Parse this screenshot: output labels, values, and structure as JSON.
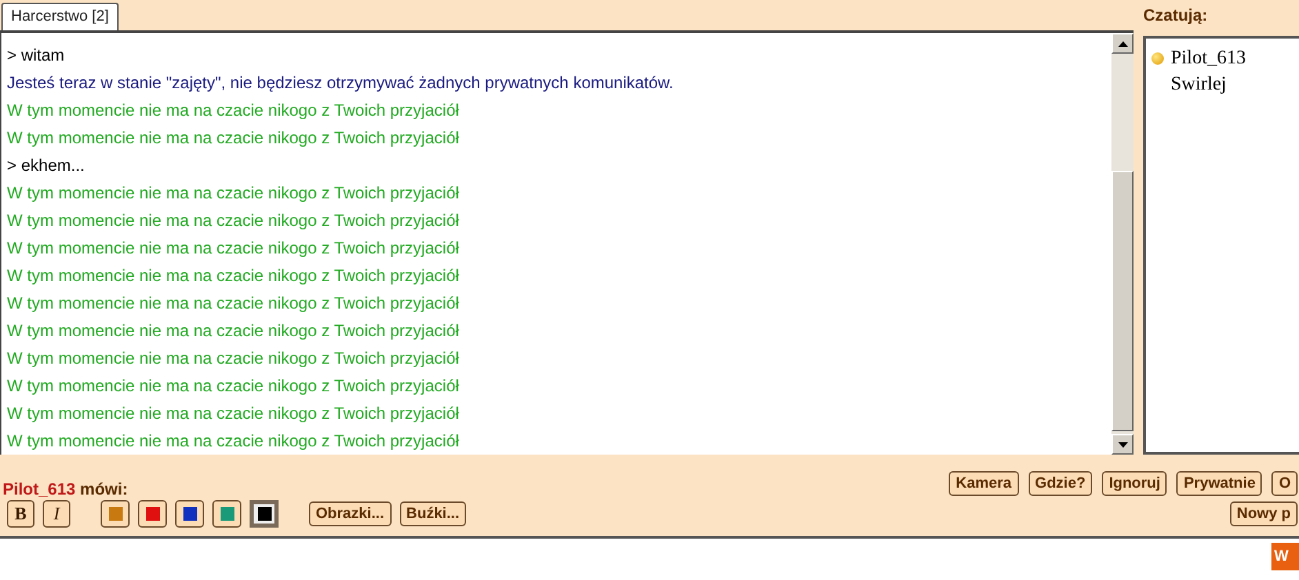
{
  "tabs": [
    {
      "label": "Harcerstwo [2]",
      "selected": true
    }
  ],
  "messages": [
    {
      "text": "> witam",
      "color": "#000000"
    },
    {
      "text": "Jesteś teraz w stanie \"zajęty\", nie będziesz otrzymywać żadnych prywatnych komunikatów.",
      "color": "#1a1a80"
    },
    {
      "text": "W tym momencie nie ma na czacie nikogo z Twoich przyjaciół",
      "color": "#22aa22"
    },
    {
      "text": "W tym momencie nie ma na czacie nikogo z Twoich przyjaciół",
      "color": "#22aa22"
    },
    {
      "text": "> ekhem...",
      "color": "#000000"
    },
    {
      "text": "W tym momencie nie ma na czacie nikogo z Twoich przyjaciół",
      "color": "#22aa22"
    },
    {
      "text": "W tym momencie nie ma na czacie nikogo z Twoich przyjaciół",
      "color": "#22aa22"
    },
    {
      "text": "W tym momencie nie ma na czacie nikogo z Twoich przyjaciół",
      "color": "#22aa22"
    },
    {
      "text": "W tym momencie nie ma na czacie nikogo z Twoich przyjaciół",
      "color": "#22aa22"
    },
    {
      "text": "W tym momencie nie ma na czacie nikogo z Twoich przyjaciół",
      "color": "#22aa22"
    },
    {
      "text": "W tym momencie nie ma na czacie nikogo z Twoich przyjaciół",
      "color": "#22aa22"
    },
    {
      "text": "W tym momencie nie ma na czacie nikogo z Twoich przyjaciół",
      "color": "#22aa22"
    },
    {
      "text": "W tym momencie nie ma na czacie nikogo z Twoich przyjaciół",
      "color": "#22aa22"
    },
    {
      "text": "W tym momencie nie ma na czacie nikogo z Twoich przyjaciół",
      "color": "#22aa22"
    },
    {
      "text": "W tym momencie nie ma na czacie nikogo z Twoich przyjaciół",
      "color": "#22aa22"
    }
  ],
  "users_panel": {
    "title": "Czatują:",
    "users": [
      {
        "name": "Pilot_613",
        "marked": true
      },
      {
        "name": "Swirlej",
        "marked": false
      }
    ]
  },
  "speaker": {
    "name": "Pilot_613",
    "verb": "mówi:"
  },
  "user_actions": [
    "Kamera",
    "Gdzie?",
    "Ignoruj",
    "Prywatnie",
    "O"
  ],
  "format_buttons": [
    {
      "label": "B",
      "kind": "bold"
    },
    {
      "label": "I",
      "kind": "italic"
    }
  ],
  "colors": [
    {
      "color": "#c87a10",
      "selected": false
    },
    {
      "color": "#e01010",
      "selected": false
    },
    {
      "color": "#1030c0",
      "selected": false
    },
    {
      "color": "#1a9a78",
      "selected": false
    },
    {
      "color": "#000000",
      "selected": true
    }
  ],
  "insert_buttons": [
    "Obrazki...",
    "Buźki..."
  ],
  "new_button": "Nowy p",
  "send_button": "W"
}
